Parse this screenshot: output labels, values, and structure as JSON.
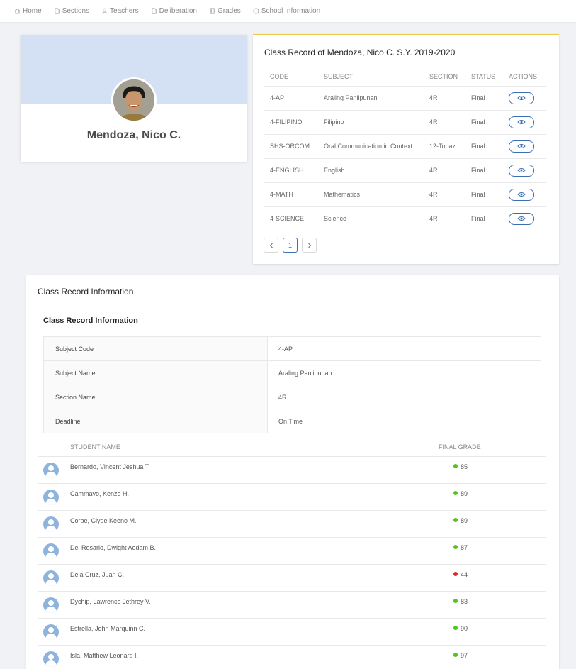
{
  "nav": [
    {
      "label": "Home",
      "icon": "home-icon"
    },
    {
      "label": "Sections",
      "icon": "file-icon"
    },
    {
      "label": "Teachers",
      "icon": "user-icon"
    },
    {
      "label": "Deliberation",
      "icon": "file-icon"
    },
    {
      "label": "Grades",
      "icon": "book-icon"
    },
    {
      "label": "School Information",
      "icon": "info-icon"
    }
  ],
  "profile": {
    "name": "Mendoza, Nico C."
  },
  "record": {
    "title": "Class Record of Mendoza, Nico C. S.Y. 2019-2020",
    "headers": {
      "code": "CODE",
      "subject": "SUBJECT",
      "section": "SECTION",
      "status": "STATUS",
      "actions": "ACTIONS"
    },
    "rows": [
      {
        "code": "4-AP",
        "subject": "Araling Panlipunan",
        "section": "4R",
        "status": "Final"
      },
      {
        "code": "4-FILIPINO",
        "subject": "Filipino",
        "section": "4R",
        "status": "Final"
      },
      {
        "code": "SHS-ORCOM",
        "subject": "Oral Communication in Context",
        "section": "12-Topaz",
        "status": "Final"
      },
      {
        "code": "4-ENGLISH",
        "subject": "English",
        "section": "4R",
        "status": "Final"
      },
      {
        "code": "4-MATH",
        "subject": "Mathematics",
        "section": "4R",
        "status": "Final"
      },
      {
        "code": "4-SCIENCE",
        "subject": "Science",
        "section": "4R",
        "status": "Final"
      }
    ],
    "pagination": {
      "current_page": "1"
    }
  },
  "info": {
    "title": "Class Record Information",
    "subtitle": "Class Record Information",
    "details": [
      {
        "label": "Subject Code",
        "value": "4-AP"
      },
      {
        "label": "Subject Name",
        "value": "Araling Panlipunan"
      },
      {
        "label": "Section Name",
        "value": "4R"
      },
      {
        "label": "Deadline",
        "value": "On Time"
      }
    ],
    "students_headers": {
      "name": "STUDENT NAME",
      "grade": "FINAL GRADE"
    },
    "students": [
      {
        "name": "Bernardo, Vincent Jeshua T.",
        "grade": "85",
        "status_color": "#52c41a"
      },
      {
        "name": "Cammayo, Kenzo H.",
        "grade": "89",
        "status_color": "#52c41a"
      },
      {
        "name": "Corbe, Clyde Keeno M.",
        "grade": "89",
        "status_color": "#52c41a"
      },
      {
        "name": "Del Rosario, Dwight Aedam B.",
        "grade": "87",
        "status_color": "#52c41a"
      },
      {
        "name": "Dela Cruz, Juan C.",
        "grade": "44",
        "status_color": "#e0282e"
      },
      {
        "name": "Dychip, Lawrence Jethrey V.",
        "grade": "83",
        "status_color": "#52c41a"
      },
      {
        "name": "Estrella, John Marquinn C.",
        "grade": "90",
        "status_color": "#52c41a"
      },
      {
        "name": "Isla, Matthew Leonard I.",
        "grade": "97",
        "status_color": "#52c41a"
      }
    ]
  }
}
